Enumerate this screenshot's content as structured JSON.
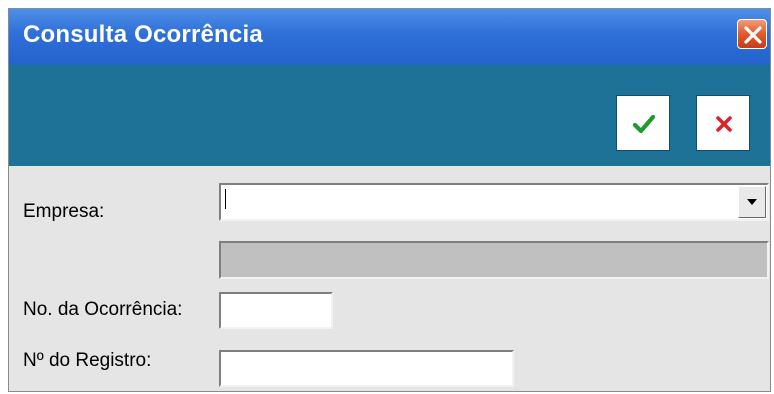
{
  "window": {
    "title": "Consulta Ocorrência",
    "close_icon": "close-x-icon"
  },
  "toolbar": {
    "confirm_icon": "checkmark-icon",
    "cancel_icon": "x-cancel-icon"
  },
  "form": {
    "empresa_label": "Empresa:",
    "empresa_value": "",
    "empresa_description_value": "",
    "ocorrencia_label": "No. da Ocorrência:",
    "ocorrencia_value": "",
    "registro_label": "Nº do Registro:",
    "registro_value": ""
  },
  "colors": {
    "title_bar": "#2f6fd8",
    "toolbar": "#1e7197",
    "confirm": "#1f9a2e",
    "cancel": "#d8262a"
  }
}
